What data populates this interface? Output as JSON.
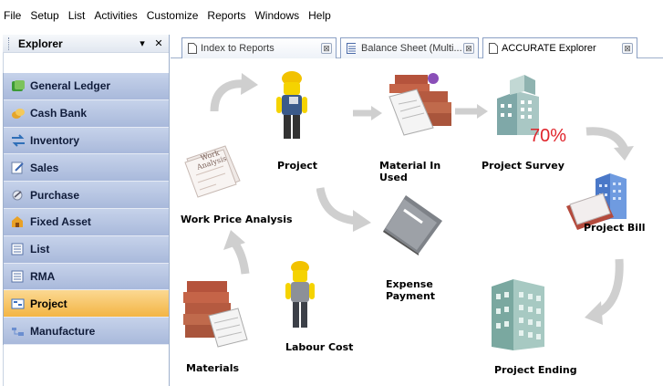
{
  "menu": {
    "items": [
      {
        "label": "File"
      },
      {
        "label": "Setup"
      },
      {
        "label": "List"
      },
      {
        "label": "Activities"
      },
      {
        "label": "Customize"
      },
      {
        "label": "Reports"
      },
      {
        "label": "Windows"
      },
      {
        "label": "Help"
      }
    ]
  },
  "explorer": {
    "title": "Explorer",
    "pin_glyph": "▾",
    "close_glyph": "✕",
    "items": [
      {
        "label": "General Ledger",
        "icon": "ledger-icon"
      },
      {
        "label": "Cash Bank",
        "icon": "cash-bank-icon"
      },
      {
        "label": "Inventory",
        "icon": "inventory-icon"
      },
      {
        "label": "Sales",
        "icon": "sales-icon"
      },
      {
        "label": "Purchase",
        "icon": "purchase-icon"
      },
      {
        "label": "Fixed Asset",
        "icon": "fixed-asset-icon"
      },
      {
        "label": "List",
        "icon": "list-icon"
      },
      {
        "label": "RMA",
        "icon": "rma-icon"
      },
      {
        "label": "Project",
        "icon": "project-icon",
        "active": true
      },
      {
        "label": "Manufacture",
        "icon": "manufacture-icon"
      }
    ]
  },
  "tabs": [
    {
      "label": "Index to Reports"
    },
    {
      "label": "Balance Sheet (Multi..."
    },
    {
      "label": "ACCURATE Explorer",
      "active": true
    }
  ],
  "diagram": {
    "project": "Project",
    "material_in_used_line1": "Material In",
    "material_in_used_line2": "Used",
    "project_survey": "Project Survey",
    "survey_percent": "70%",
    "work_price_analysis": "Work Price Analysis",
    "work_analysis_doc_line1": "Work",
    "work_analysis_doc_line2": "Analysis",
    "expense_payment_line1": "Expense",
    "expense_payment_line2": "Payment",
    "project_bill": "Project Bill",
    "materials": "Materials",
    "labour_cost": "Labour Cost",
    "project_ending": "Project Ending"
  },
  "colors": {
    "nav_bg": "#b3c2e0",
    "nav_active": "#f6c25c",
    "arrow_gray": "#c8c8c8",
    "percent_red": "#e0242b"
  }
}
